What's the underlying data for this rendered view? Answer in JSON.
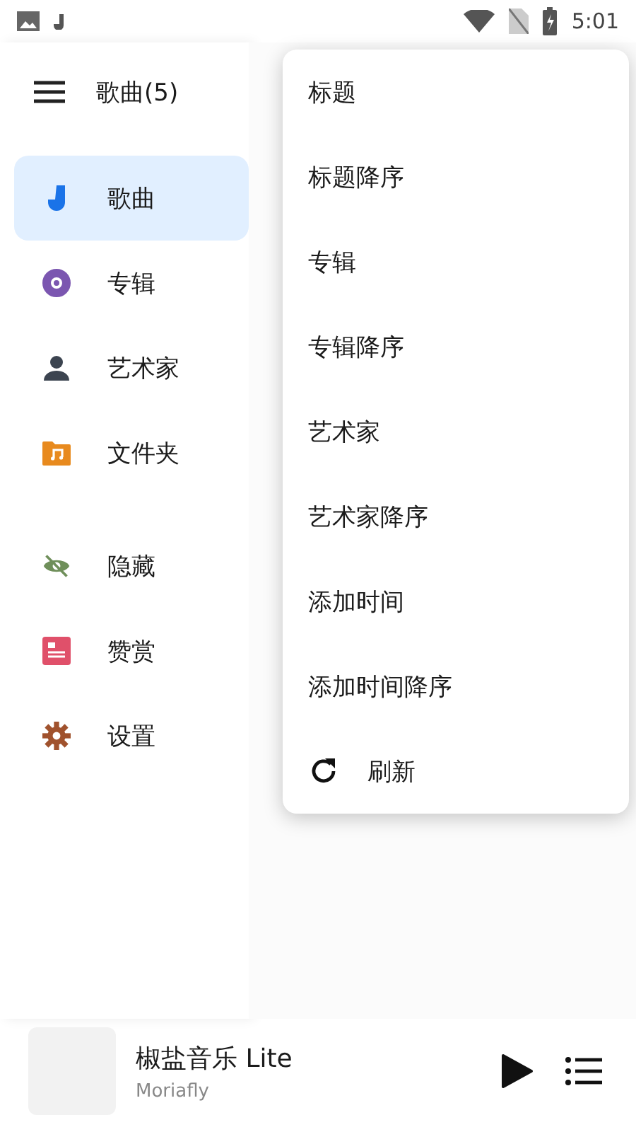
{
  "status_bar": {
    "time": "5:01"
  },
  "header": {
    "title": "歌曲(5)"
  },
  "drawer": {
    "sections": [
      [
        {
          "label": "歌曲",
          "selected": true
        },
        {
          "label": "专辑",
          "selected": false
        },
        {
          "label": "艺术家",
          "selected": false
        },
        {
          "label": "文件夹",
          "selected": false
        }
      ],
      [
        {
          "label": "隐藏",
          "selected": false
        },
        {
          "label": "赞赏",
          "selected": false
        },
        {
          "label": "设置",
          "selected": false
        }
      ]
    ]
  },
  "sort_menu": {
    "items": [
      {
        "kind": "option",
        "label": "标题"
      },
      {
        "kind": "option",
        "label": "标题降序"
      },
      {
        "kind": "option",
        "label": "专辑"
      },
      {
        "kind": "option",
        "label": "专辑降序"
      },
      {
        "kind": "option",
        "label": "艺术家"
      },
      {
        "kind": "option",
        "label": "艺术家降序"
      },
      {
        "kind": "option",
        "label": "添加时间"
      },
      {
        "kind": "option",
        "label": "添加时间降序"
      },
      {
        "kind": "refresh",
        "label": "刷新"
      }
    ]
  },
  "player": {
    "title": "椒盐音乐 Lite",
    "artist": "Moriafly"
  }
}
